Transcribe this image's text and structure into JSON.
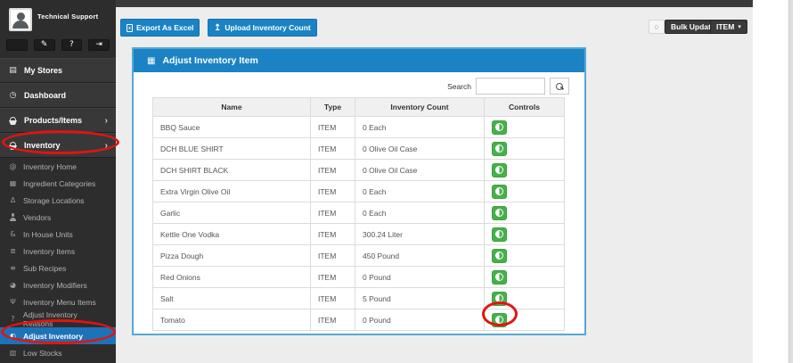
{
  "sidebar": {
    "profile": {
      "name": "Technical Support"
    },
    "quick_actions": [
      {
        "icon": "user"
      },
      {
        "icon": "edit"
      },
      {
        "icon": "help"
      },
      {
        "icon": "logout"
      }
    ],
    "main_items": [
      {
        "label": "My Stores",
        "icon": "store",
        "chevron": false
      },
      {
        "label": "Dashboard",
        "icon": "gauge",
        "chevron": false
      },
      {
        "label": "Products/Items",
        "icon": "basket",
        "chevron": true
      },
      {
        "label": "Inventory",
        "icon": "basket",
        "chevron": true,
        "annotated": true
      }
    ],
    "sub_items": [
      {
        "label": "Inventory Home",
        "icon": "home"
      },
      {
        "label": "Ingredient Categories",
        "icon": "grid"
      },
      {
        "label": "Storage Locations",
        "icon": "flask"
      },
      {
        "label": "Vendors",
        "icon": "person"
      },
      {
        "label": "In House Units",
        "icon": "units"
      },
      {
        "label": "Inventory Items",
        "icon": "list"
      },
      {
        "label": "Sub Recipes",
        "icon": "stack"
      },
      {
        "label": "Inventory Modifiers",
        "icon": "pie"
      },
      {
        "label": "Inventory Menu Items",
        "icon": "utensils"
      },
      {
        "label": "Adjust Inventory Reasons",
        "icon": "question"
      },
      {
        "label": "Adjust Inventory",
        "icon": "adjust",
        "active": true,
        "annotated": true
      },
      {
        "label": "Low Stocks",
        "icon": "archive"
      }
    ]
  },
  "toolbar": {
    "export_label": "Export As Excel",
    "upload_label": "Upload Inventory Count",
    "bulk_update_label": "Bulk Update",
    "type_dropdown_label": "ITEM"
  },
  "panel": {
    "title": "Adjust Inventory Item",
    "search_label": "Search",
    "search_value": ""
  },
  "table": {
    "headers": [
      "Name",
      "Type",
      "Inventory Count",
      "Controls"
    ],
    "rows": [
      {
        "name": "BBQ Sauce",
        "type": "ITEM",
        "count": "0 Each"
      },
      {
        "name": "DCH BLUE SHIRT",
        "type": "ITEM",
        "count": "0 Olive Oil Case"
      },
      {
        "name": "DCH SHIRT BLACK",
        "type": "ITEM",
        "count": "0 Olive Oil Case"
      },
      {
        "name": "Extra Virgin Olive Oil",
        "type": "ITEM",
        "count": "0 Each"
      },
      {
        "name": "Garlic",
        "type": "ITEM",
        "count": "0 Each"
      },
      {
        "name": "Kettle One Vodka",
        "type": "ITEM",
        "count": "300.24 Liter"
      },
      {
        "name": "Pizza Dough",
        "type": "ITEM",
        "count": "450 Pound"
      },
      {
        "name": "Red Onions",
        "type": "ITEM",
        "count": "0 Pound"
      },
      {
        "name": "Salt",
        "type": "ITEM",
        "count": "5 Pound"
      },
      {
        "name": "Tomato",
        "type": "ITEM",
        "count": "0 Pound",
        "annotated": true
      }
    ]
  },
  "annotations": {
    "circled": [
      "sidebar-item-inventory",
      "sidebar-item-adjust-inventory",
      "tomato-adjust-button"
    ],
    "color": "#e11410"
  },
  "colors": {
    "accent_blue": "#1b83c4",
    "panel_border": "#54a8d6",
    "active_item_blue": "#1d72b8",
    "green_button": "#47b04b",
    "sidebar_bg": "#2d2d2d",
    "content_bg": "#ededed"
  }
}
